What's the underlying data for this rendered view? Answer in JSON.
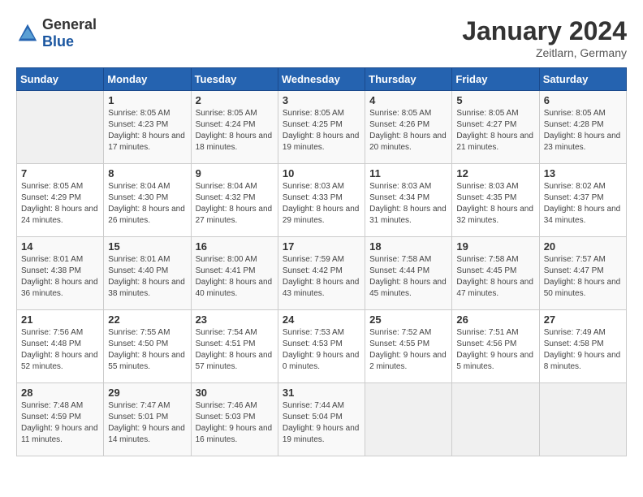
{
  "header": {
    "logo_general": "General",
    "logo_blue": "Blue",
    "month_title": "January 2024",
    "location": "Zeitlarn, Germany"
  },
  "days_of_week": [
    "Sunday",
    "Monday",
    "Tuesday",
    "Wednesday",
    "Thursday",
    "Friday",
    "Saturday"
  ],
  "weeks": [
    [
      {
        "day": "",
        "sunrise": "",
        "sunset": "",
        "daylight": ""
      },
      {
        "day": "1",
        "sunrise": "Sunrise: 8:05 AM",
        "sunset": "Sunset: 4:23 PM",
        "daylight": "Daylight: 8 hours and 17 minutes."
      },
      {
        "day": "2",
        "sunrise": "Sunrise: 8:05 AM",
        "sunset": "Sunset: 4:24 PM",
        "daylight": "Daylight: 8 hours and 18 minutes."
      },
      {
        "day": "3",
        "sunrise": "Sunrise: 8:05 AM",
        "sunset": "Sunset: 4:25 PM",
        "daylight": "Daylight: 8 hours and 19 minutes."
      },
      {
        "day": "4",
        "sunrise": "Sunrise: 8:05 AM",
        "sunset": "Sunset: 4:26 PM",
        "daylight": "Daylight: 8 hours and 20 minutes."
      },
      {
        "day": "5",
        "sunrise": "Sunrise: 8:05 AM",
        "sunset": "Sunset: 4:27 PM",
        "daylight": "Daylight: 8 hours and 21 minutes."
      },
      {
        "day": "6",
        "sunrise": "Sunrise: 8:05 AM",
        "sunset": "Sunset: 4:28 PM",
        "daylight": "Daylight: 8 hours and 23 minutes."
      }
    ],
    [
      {
        "day": "7",
        "sunrise": "Sunrise: 8:05 AM",
        "sunset": "Sunset: 4:29 PM",
        "daylight": "Daylight: 8 hours and 24 minutes."
      },
      {
        "day": "8",
        "sunrise": "Sunrise: 8:04 AM",
        "sunset": "Sunset: 4:30 PM",
        "daylight": "Daylight: 8 hours and 26 minutes."
      },
      {
        "day": "9",
        "sunrise": "Sunrise: 8:04 AM",
        "sunset": "Sunset: 4:32 PM",
        "daylight": "Daylight: 8 hours and 27 minutes."
      },
      {
        "day": "10",
        "sunrise": "Sunrise: 8:03 AM",
        "sunset": "Sunset: 4:33 PM",
        "daylight": "Daylight: 8 hours and 29 minutes."
      },
      {
        "day": "11",
        "sunrise": "Sunrise: 8:03 AM",
        "sunset": "Sunset: 4:34 PM",
        "daylight": "Daylight: 8 hours and 31 minutes."
      },
      {
        "day": "12",
        "sunrise": "Sunrise: 8:03 AM",
        "sunset": "Sunset: 4:35 PM",
        "daylight": "Daylight: 8 hours and 32 minutes."
      },
      {
        "day": "13",
        "sunrise": "Sunrise: 8:02 AM",
        "sunset": "Sunset: 4:37 PM",
        "daylight": "Daylight: 8 hours and 34 minutes."
      }
    ],
    [
      {
        "day": "14",
        "sunrise": "Sunrise: 8:01 AM",
        "sunset": "Sunset: 4:38 PM",
        "daylight": "Daylight: 8 hours and 36 minutes."
      },
      {
        "day": "15",
        "sunrise": "Sunrise: 8:01 AM",
        "sunset": "Sunset: 4:40 PM",
        "daylight": "Daylight: 8 hours and 38 minutes."
      },
      {
        "day": "16",
        "sunrise": "Sunrise: 8:00 AM",
        "sunset": "Sunset: 4:41 PM",
        "daylight": "Daylight: 8 hours and 40 minutes."
      },
      {
        "day": "17",
        "sunrise": "Sunrise: 7:59 AM",
        "sunset": "Sunset: 4:42 PM",
        "daylight": "Daylight: 8 hours and 43 minutes."
      },
      {
        "day": "18",
        "sunrise": "Sunrise: 7:58 AM",
        "sunset": "Sunset: 4:44 PM",
        "daylight": "Daylight: 8 hours and 45 minutes."
      },
      {
        "day": "19",
        "sunrise": "Sunrise: 7:58 AM",
        "sunset": "Sunset: 4:45 PM",
        "daylight": "Daylight: 8 hours and 47 minutes."
      },
      {
        "day": "20",
        "sunrise": "Sunrise: 7:57 AM",
        "sunset": "Sunset: 4:47 PM",
        "daylight": "Daylight: 8 hours and 50 minutes."
      }
    ],
    [
      {
        "day": "21",
        "sunrise": "Sunrise: 7:56 AM",
        "sunset": "Sunset: 4:48 PM",
        "daylight": "Daylight: 8 hours and 52 minutes."
      },
      {
        "day": "22",
        "sunrise": "Sunrise: 7:55 AM",
        "sunset": "Sunset: 4:50 PM",
        "daylight": "Daylight: 8 hours and 55 minutes."
      },
      {
        "day": "23",
        "sunrise": "Sunrise: 7:54 AM",
        "sunset": "Sunset: 4:51 PM",
        "daylight": "Daylight: 8 hours and 57 minutes."
      },
      {
        "day": "24",
        "sunrise": "Sunrise: 7:53 AM",
        "sunset": "Sunset: 4:53 PM",
        "daylight": "Daylight: 9 hours and 0 minutes."
      },
      {
        "day": "25",
        "sunrise": "Sunrise: 7:52 AM",
        "sunset": "Sunset: 4:55 PM",
        "daylight": "Daylight: 9 hours and 2 minutes."
      },
      {
        "day": "26",
        "sunrise": "Sunrise: 7:51 AM",
        "sunset": "Sunset: 4:56 PM",
        "daylight": "Daylight: 9 hours and 5 minutes."
      },
      {
        "day": "27",
        "sunrise": "Sunrise: 7:49 AM",
        "sunset": "Sunset: 4:58 PM",
        "daylight": "Daylight: 9 hours and 8 minutes."
      }
    ],
    [
      {
        "day": "28",
        "sunrise": "Sunrise: 7:48 AM",
        "sunset": "Sunset: 4:59 PM",
        "daylight": "Daylight: 9 hours and 11 minutes."
      },
      {
        "day": "29",
        "sunrise": "Sunrise: 7:47 AM",
        "sunset": "Sunset: 5:01 PM",
        "daylight": "Daylight: 9 hours and 14 minutes."
      },
      {
        "day": "30",
        "sunrise": "Sunrise: 7:46 AM",
        "sunset": "Sunset: 5:03 PM",
        "daylight": "Daylight: 9 hours and 16 minutes."
      },
      {
        "day": "31",
        "sunrise": "Sunrise: 7:44 AM",
        "sunset": "Sunset: 5:04 PM",
        "daylight": "Daylight: 9 hours and 19 minutes."
      },
      {
        "day": "",
        "sunrise": "",
        "sunset": "",
        "daylight": ""
      },
      {
        "day": "",
        "sunrise": "",
        "sunset": "",
        "daylight": ""
      },
      {
        "day": "",
        "sunrise": "",
        "sunset": "",
        "daylight": ""
      }
    ]
  ]
}
